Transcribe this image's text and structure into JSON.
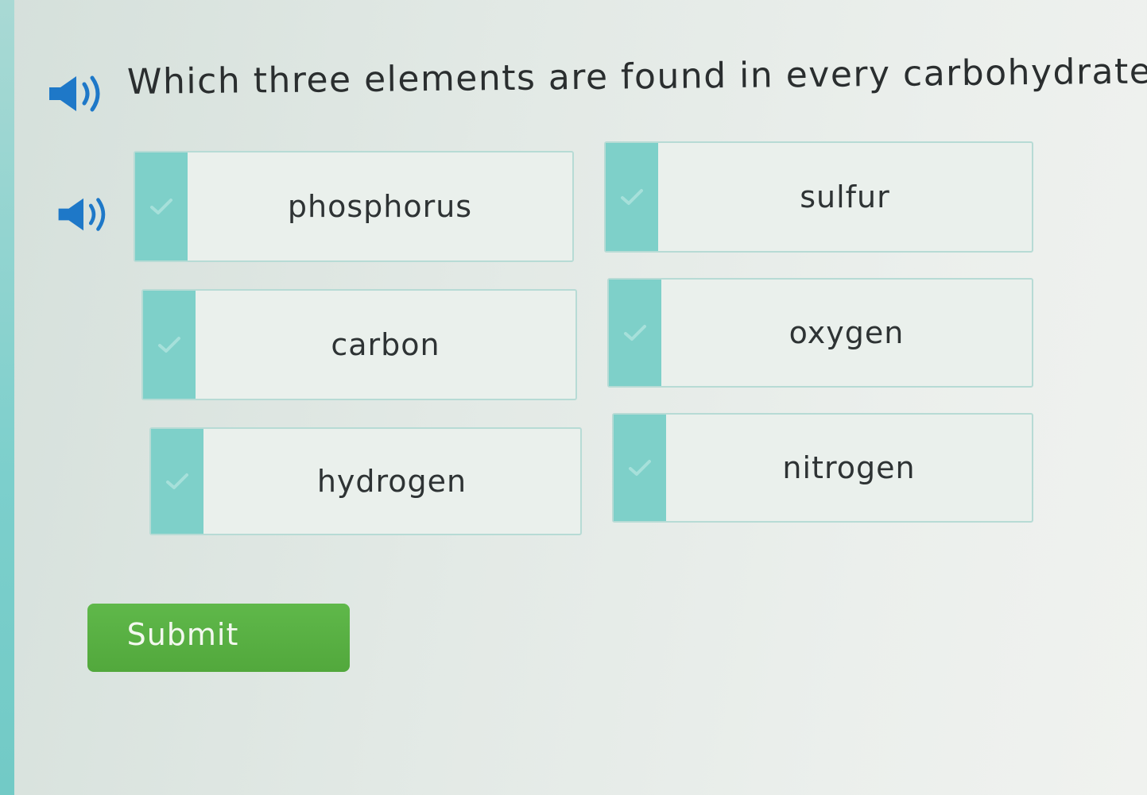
{
  "question": {
    "text": "Which three elements are found in every carbohydrate?",
    "audio_icon": "speaker-icon"
  },
  "answers_audio_icon": "speaker-icon",
  "options": [
    {
      "id": "phosphorus",
      "label": "phosphorus",
      "selected": false
    },
    {
      "id": "sulfur",
      "label": "sulfur",
      "selected": false
    },
    {
      "id": "carbon",
      "label": "carbon",
      "selected": false
    },
    {
      "id": "oxygen",
      "label": "oxygen",
      "selected": false
    },
    {
      "id": "hydrogen",
      "label": "hydrogen",
      "selected": false
    },
    {
      "id": "nitrogen",
      "label": "nitrogen",
      "selected": false
    }
  ],
  "submit": {
    "label": "Submit"
  },
  "colors": {
    "checkbox": "#7ed0c9",
    "submit": "#55ad3f",
    "strip": "#7ccfcc"
  }
}
